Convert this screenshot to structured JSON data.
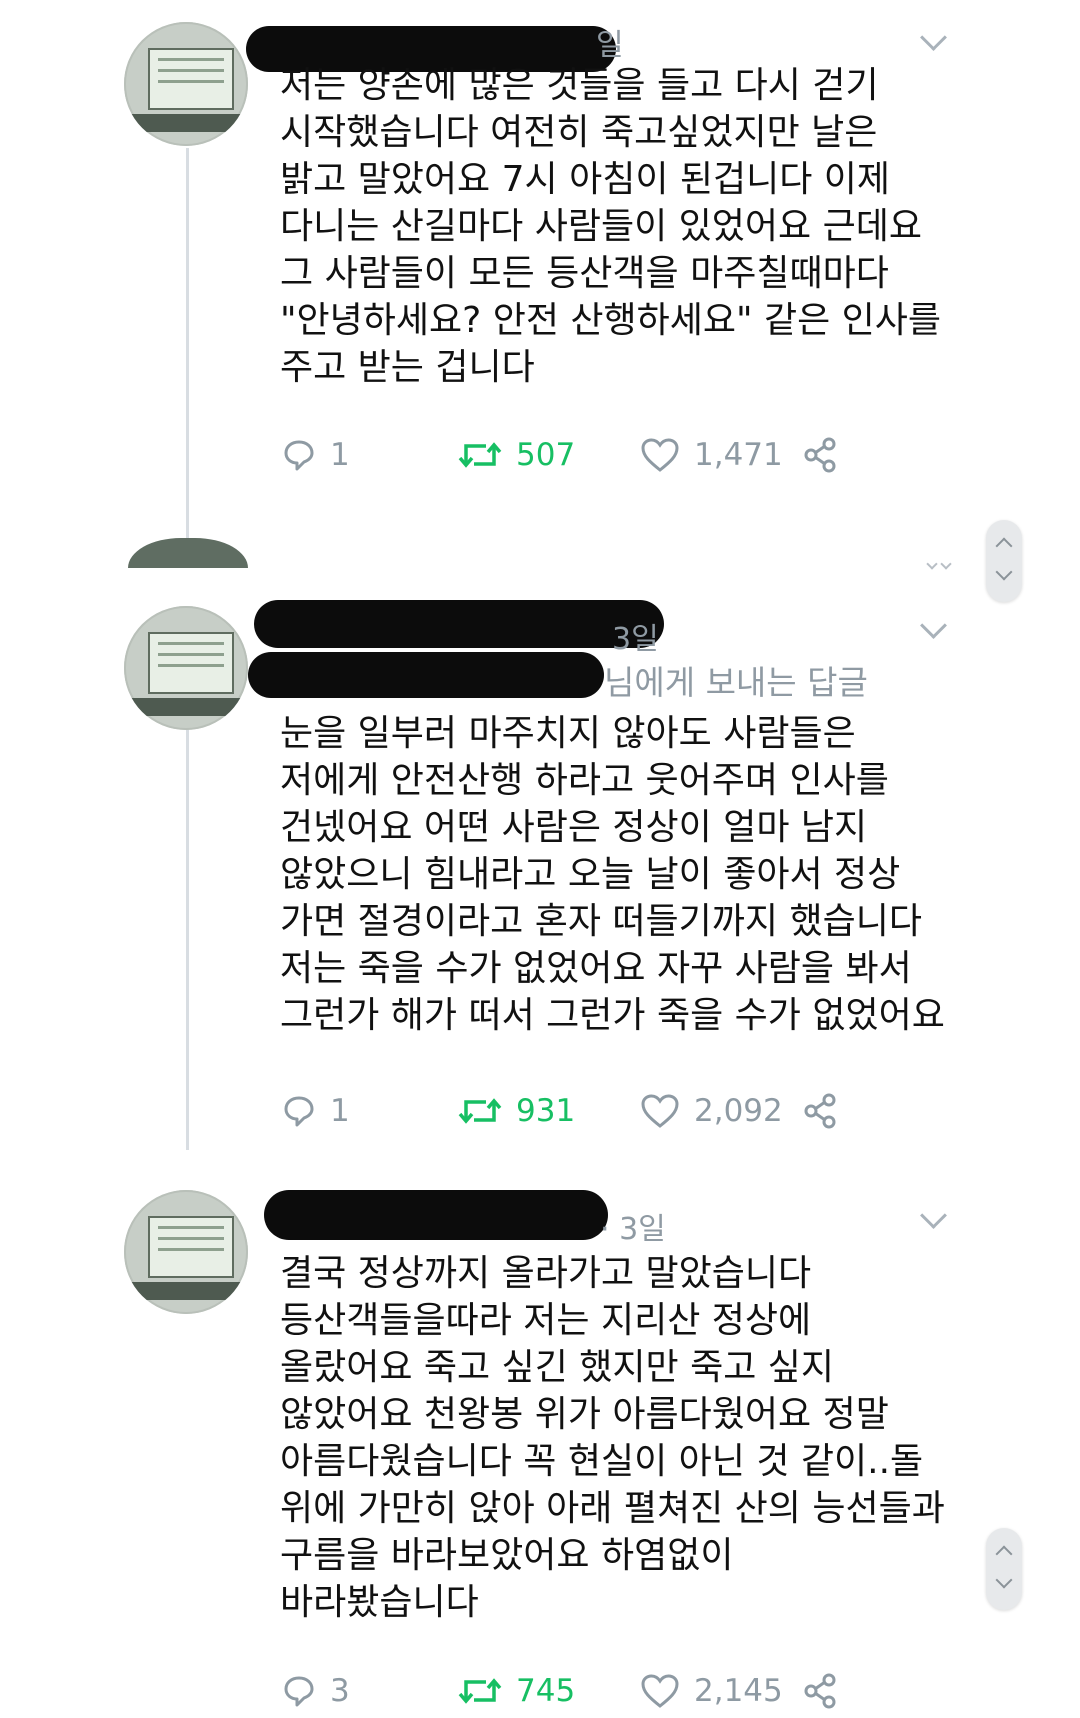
{
  "tweets": [
    {
      "time": "일",
      "reply_to": "",
      "text": "저는 양손에 많은 것들을 들고 다시 걷기\n시작했습니다 여전히 죽고싶었지만 날은\n밝고 말았어요 7시 아침이 된겁니다 이제\n다니는 산길마다 사람들이 있었어요 근데요\n그 사람들이 모든 등산객을 마주칠때마다\n\"안녕하세요? 안전 산행하세요\" 같은 인사를\n주고 받는 겁니다",
      "replies": "1",
      "retweets": "507",
      "likes": "1,471"
    },
    {
      "time": "3일",
      "reply_to": "님에게 보내는 답글",
      "text": "눈을 일부러 마주치지 않아도 사람들은\n저에게 안전산행 하라고 웃어주며 인사를\n건넸어요 어떤 사람은 정상이 얼마 남지\n않았으니 힘내라고 오늘 날이 좋아서 정상\n가면 절경이라고 혼자 떠들기까지 했습니다\n저는 죽을 수가 없었어요 자꾸 사람을 봐서\n그런가 해가 떠서 그런가 죽을 수가 없었어요",
      "replies": "1",
      "retweets": "931",
      "likes": "2,092"
    },
    {
      "time": "· 3일",
      "reply_to": "",
      "text": "결국 정상까지 올라가고 말았습니다\n등산객들을따라 저는 지리산 정상에\n올랐어요 죽고 싶긴 했지만 죽고 싶지\n않았어요 천왕봉 위가 아름다웠어요 정말\n아름다웠습니다 꼭 현실이 아닌 것 같이..돌\n위에 가만히 앉아 아래 펼쳐진 산의 능선들과\n구름을 바라보았어요 하염없이\n바라봤습니다",
      "replies": "3",
      "retweets": "745",
      "likes": "2,145"
    }
  ],
  "icons": {
    "reply": "speech-bubble-icon",
    "retweet": "retweet-arrows-icon",
    "like": "heart-outline-icon",
    "share": "share-nodes-icon",
    "menu": "chevron-down-icon"
  },
  "colors": {
    "retweet_green": "#17bf63",
    "muted_gray": "#8f9aa3",
    "thread_line": "#d8dde2"
  }
}
